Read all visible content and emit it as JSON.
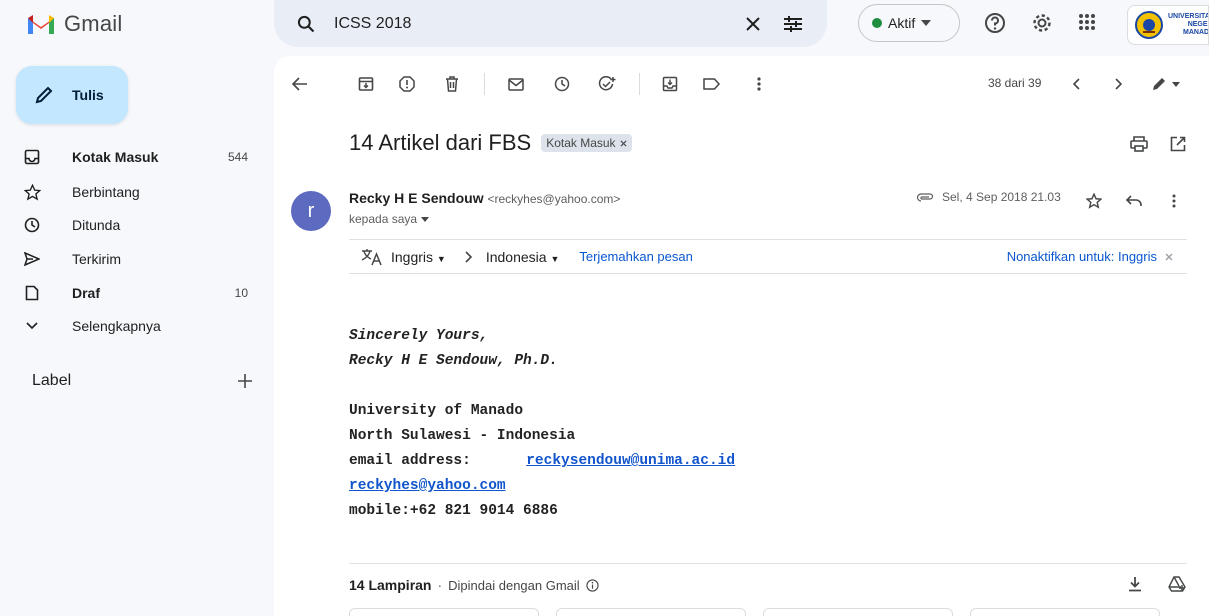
{
  "app": {
    "name": "Gmail"
  },
  "search": {
    "value": "ICSS 2018"
  },
  "status": {
    "label": "Aktif"
  },
  "org_logo": {
    "line1": "UNIVERSITAS",
    "line2": "NEGERI",
    "line3": "MANADO"
  },
  "sidebar": {
    "compose_label": "Tulis",
    "items": [
      {
        "label": "Kotak Masuk",
        "count": "544",
        "icon": "inbox-icon",
        "bold": true
      },
      {
        "label": "Berbintang",
        "count": "",
        "icon": "star-icon",
        "bold": false
      },
      {
        "label": "Ditunda",
        "count": "",
        "icon": "clock-icon",
        "bold": false
      },
      {
        "label": "Terkirim",
        "count": "",
        "icon": "send-icon",
        "bold": false
      },
      {
        "label": "Draf",
        "count": "10",
        "icon": "draft-icon",
        "bold": true
      },
      {
        "label": "Selengkapnya",
        "count": "",
        "icon": "chevron-down-icon",
        "bold": false
      }
    ],
    "labels_heading": "Label"
  },
  "toolbar": {
    "pager": "38 dari 39"
  },
  "email": {
    "subject": "14 Artikel dari FBS",
    "chip_label": "Kotak Masuk",
    "avatar_letter": "r",
    "sender_name": "Recky H E Sendouw",
    "sender_email": "<reckyhes@yahoo.com>",
    "to": "kepada saya",
    "date": "Sel, 4 Sep 2018 21.03",
    "translate": {
      "from": "Inggris",
      "to": "Indonesia",
      "action": "Terjemahkan pesan",
      "disable": "Nonaktifkan untuk: Inggris"
    },
    "body": {
      "closing": "Sincerely Yours,",
      "signature": "Recky H E Sendouw, Ph.D.",
      "org": "University of Manado",
      "region": "North Sulawesi - Indonesia",
      "email_label": "email address:",
      "email1": "reckysendouw@unima.ac.id",
      "email2": "reckyhes@yahoo.com",
      "mobile": "mobile:+62 821 9014 6886"
    },
    "attachments": {
      "count_label": "14 Lampiran",
      "scan_label": "Dipindai dengan Gmail"
    }
  }
}
